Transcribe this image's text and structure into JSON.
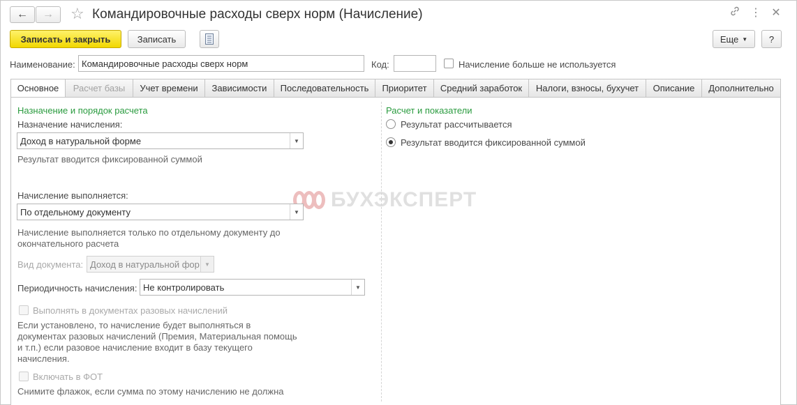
{
  "window": {
    "title": "Командировочные расходы сверх норм (Начисление)",
    "back_icon": "arrow-left-icon",
    "forward_icon": "arrow-right-icon",
    "favorite_icon": "star-icon",
    "link_icon": "link-icon",
    "more_icon": "vertical-dots-icon",
    "close_icon": "close-icon"
  },
  "toolbar": {
    "save_close_label": "Записать и закрыть",
    "save_label": "Записать",
    "doc_icon": "document-list-icon",
    "more_label": "Еще",
    "help_label": "?"
  },
  "header": {
    "name_label": "Наименование:",
    "name_value": "Командировочные расходы сверх норм",
    "code_label": "Код:",
    "code_value": "",
    "not_used_label": "Начисление больше не используется"
  },
  "tabs": [
    {
      "label": "Основное"
    },
    {
      "label": "Расчет базы"
    },
    {
      "label": "Учет времени"
    },
    {
      "label": "Зависимости"
    },
    {
      "label": "Последовательность"
    },
    {
      "label": "Приоритет"
    },
    {
      "label": "Средний заработок"
    },
    {
      "label": "Налоги, взносы, бухучет"
    },
    {
      "label": "Описание"
    },
    {
      "label": "Дополнительно"
    }
  ],
  "left": {
    "section_title": "Назначение и порядок расчета",
    "purpose_label": "Назначение начисления:",
    "purpose_value": "Доход в натуральной форме",
    "purpose_desc": "Результат вводится фиксированной суммой",
    "exec_label": "Начисление выполняется:",
    "exec_value": "По отдельному документу",
    "exec_desc_1": "Начисление выполняется только по отдельному документу до",
    "exec_desc_2": "окончательного расчета",
    "doc_kind_label": "Вид документа:",
    "doc_kind_value": "Доход в натуральной фор",
    "period_label": "Периодичность начисления:",
    "period_value": "Не контролировать",
    "one_time_label": "Выполнять в документах разовых начислений",
    "one_time_desc_1": "Если установлено, то начисление будет выполняться в",
    "one_time_desc_2": "документах разовых начислений (Премия, Материальная помощь",
    "one_time_desc_3": "и т.п.) если разовое начисление входит в базу текущего",
    "one_time_desc_4": "начисления.",
    "fot_label": "Включать в ФОТ",
    "fot_desc": "Снимите флажок, если сумма по этому начислению не должна"
  },
  "right": {
    "section_title": "Расчет и показатели",
    "radio_calc": "Результат рассчитывается",
    "radio_fixed": "Результат вводится фиксированной суммой",
    "selected": "fixed"
  },
  "watermark": {
    "text": "БУХЭКСПЕРТ"
  }
}
